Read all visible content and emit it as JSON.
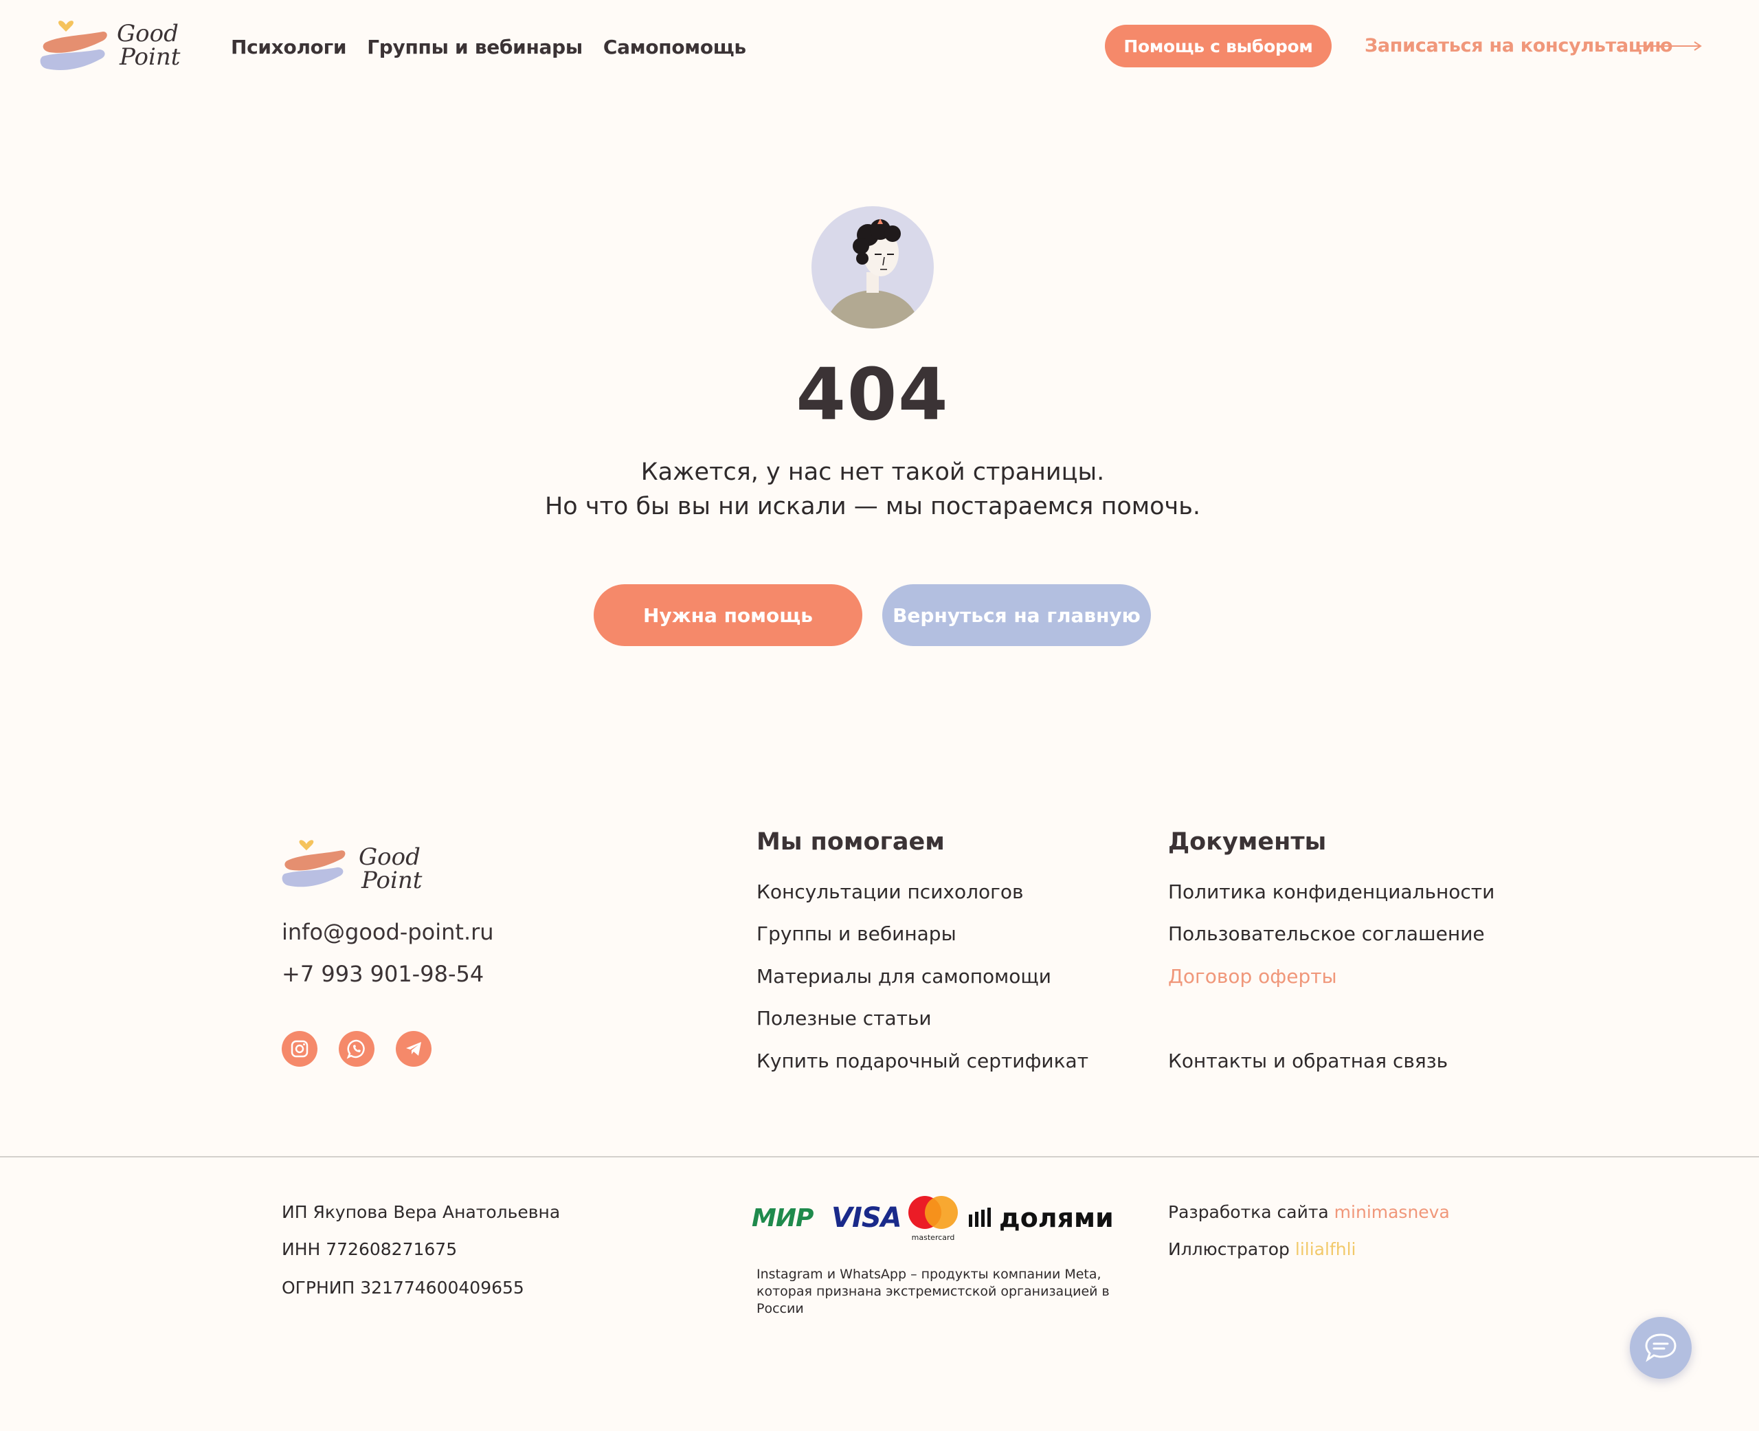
{
  "colors": {
    "accent": "#f5896a",
    "accent_text": "#f0977a",
    "secondary": "#b3bfe0",
    "background": "#fffbf7",
    "text": "#3b3335"
  },
  "header": {
    "logo_line1": "Good",
    "logo_line2": "Point",
    "nav": [
      "Психологи",
      "Группы и вебинары",
      "Самопомощь"
    ],
    "help_button": "Помощь с выбором",
    "consult_link": "Записаться на консультацию"
  },
  "main": {
    "code": "404",
    "message_line1": "Кажется, у нас нет такой страницы.",
    "message_line2": "Но что бы вы ни искали — мы постараемся помочь.",
    "need_help_button": "Нужна помощь",
    "home_button": "Вернуться на главную"
  },
  "footer": {
    "logo_line1": "Good",
    "logo_line2": "Point",
    "email": "info@good-point.ru",
    "phone": "+7 993 901-98-54",
    "social_icons": [
      "instagram-icon",
      "whatsapp-icon",
      "telegram-icon"
    ],
    "help_heading": "Мы помогаем",
    "help_links": [
      "Консультации психологов",
      "Группы и вебинары",
      "Материалы для самопомощи",
      "Полезные статьи",
      "Купить подарочный сертификат"
    ],
    "docs_heading": "Документы",
    "docs_links": [
      "Политика конфиденциальности",
      "Пользовательское соглашение",
      "Договор оферты"
    ],
    "contacts_link": "Контакты и обратная связь",
    "ip_name": "ИП Якупова Вера Анатольевна",
    "inn": "ИНН 772608271675",
    "ogrnip": "ОГРНИП 321774600409655",
    "payment": {
      "mir": "МИР",
      "visa": "VISA",
      "mastercard": "mastercard",
      "dolyami": "долями"
    },
    "meta_note_line1": "Instagram и WhatsApp – продукты компании Meta,",
    "meta_note_line2": "которая признана экстремистской организацией в России",
    "dev_label": "Разработка сайта",
    "dev_name": "minimasneva",
    "illustrator_label": "Иллюстратор",
    "illustrator_name": "lilialfhli"
  }
}
